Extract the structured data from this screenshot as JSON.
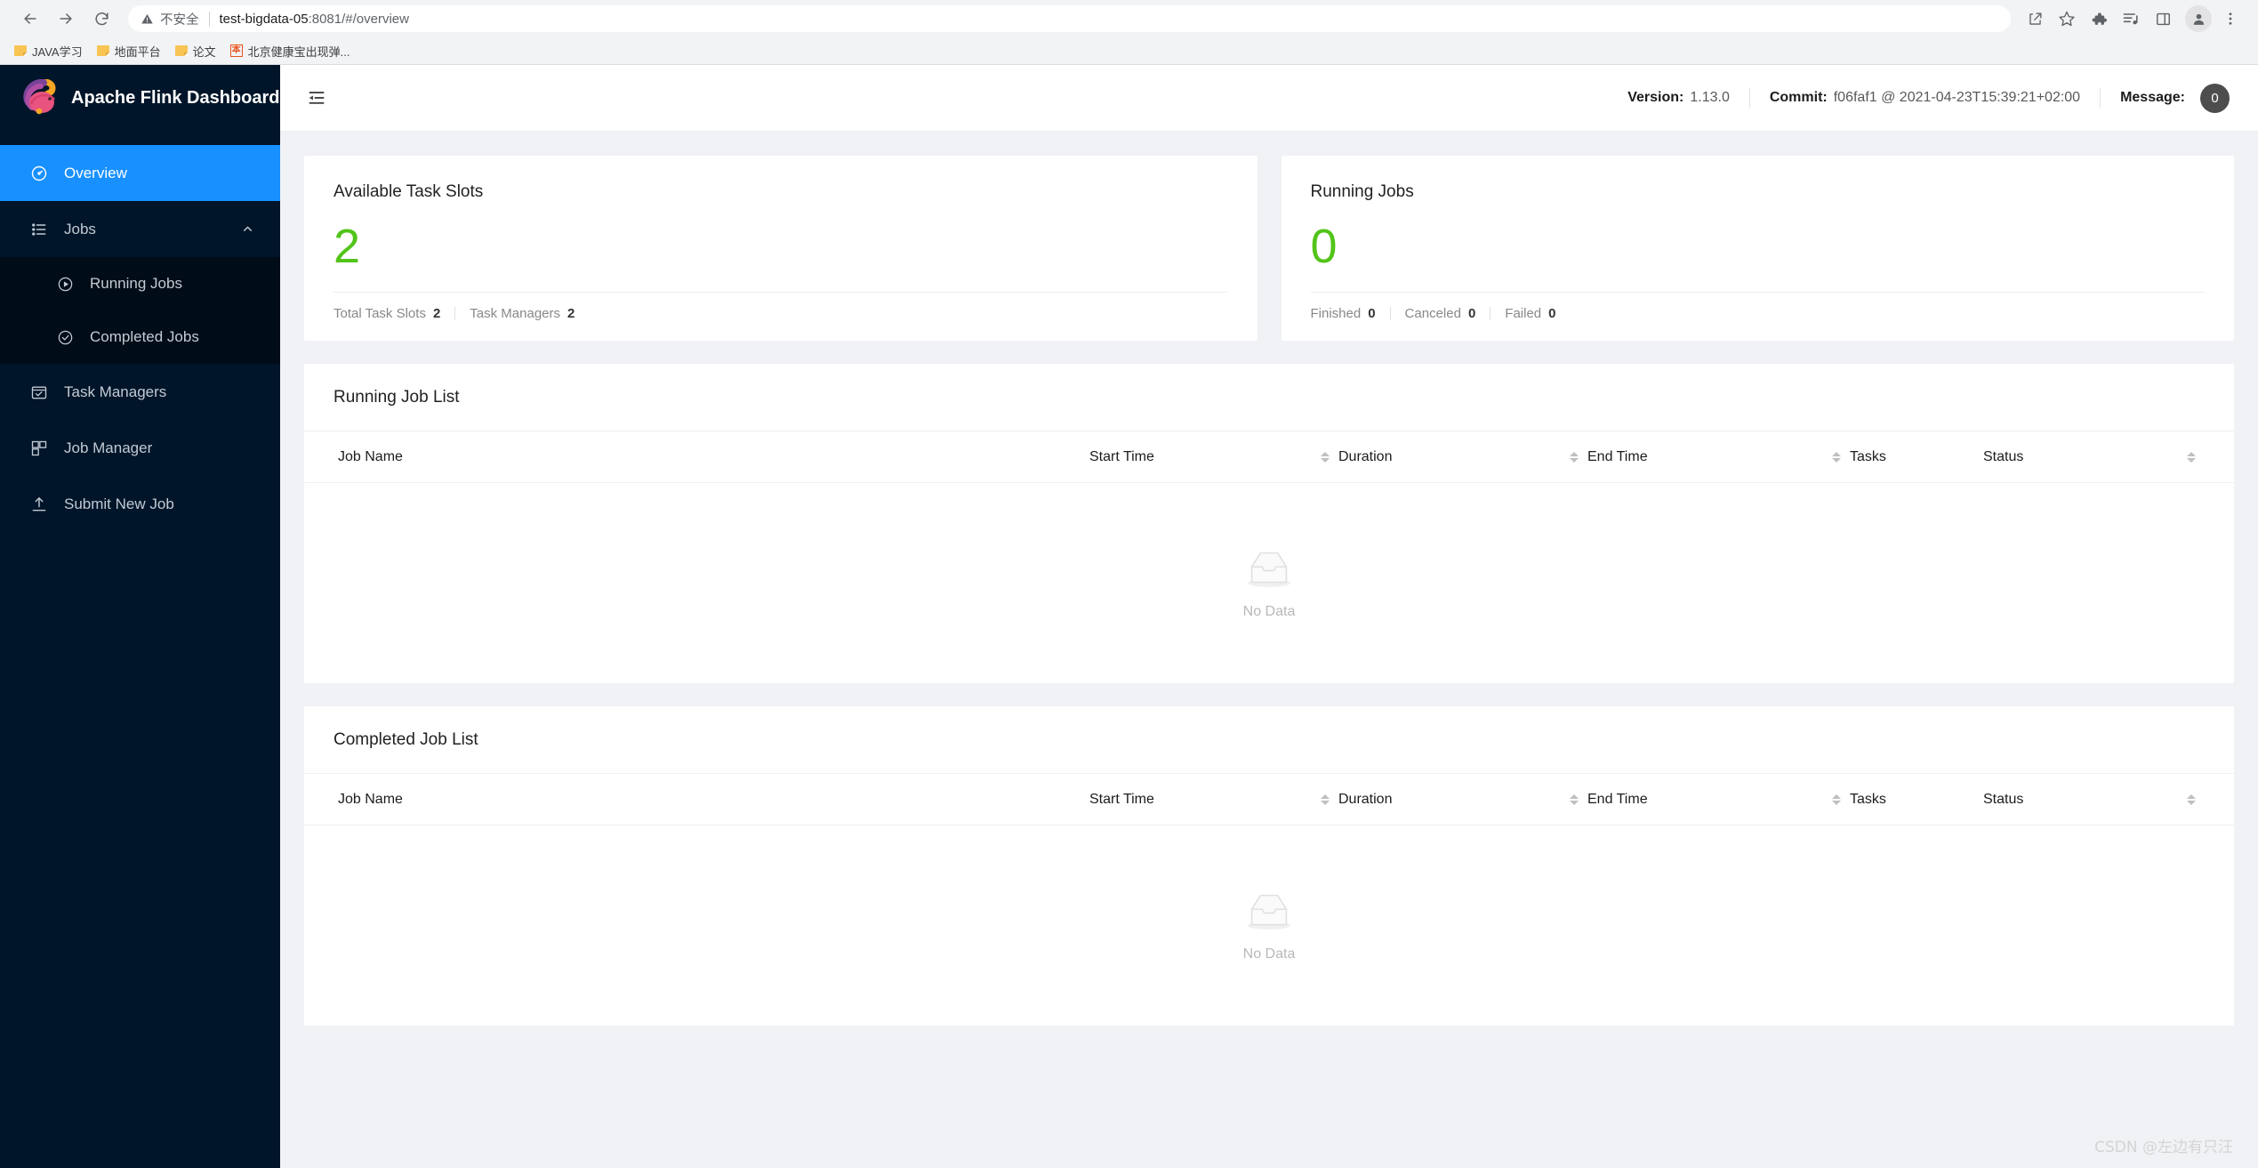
{
  "browser": {
    "back_title": "Back",
    "forward_title": "Forward",
    "reload_title": "Reload",
    "security_label": "不安全",
    "url_main": "test-bigdata-05",
    "url_rest": ":8081/#/overview",
    "toolbar_icons": [
      {
        "name": "share-icon",
        "title": "Share this page"
      },
      {
        "name": "bookmark-star-icon",
        "title": "Bookmark this tab"
      },
      {
        "name": "extensions-puzzle-icon",
        "title": "Extensions"
      },
      {
        "name": "media-playlist-icon",
        "title": "Media controls"
      },
      {
        "name": "side-panel-icon",
        "title": "Side panel"
      },
      {
        "name": "profile-avatar-icon",
        "title": "Profile"
      },
      {
        "name": "more-vertical-icon",
        "title": "Customize and control Chrome"
      }
    ],
    "bookmarks": [
      {
        "label": "JAVA学习",
        "icon": "folder-icon"
      },
      {
        "label": "地面平台",
        "icon": "folder-icon"
      },
      {
        "label": "论文",
        "icon": "folder-icon"
      },
      {
        "label": "北京健康宝出现弹...",
        "icon": "site-favicon-ben"
      }
    ]
  },
  "sidebar": {
    "brand_title": "Apache Flink Dashboard",
    "brand_logo_icon": "flink-squirrel-logo",
    "items": [
      {
        "label": "Overview",
        "icon": "dashboard-gauge-icon",
        "active": true
      },
      {
        "label": "Jobs",
        "icon": "list-icon",
        "active": false,
        "expandable": true,
        "caret": "chevron-up-icon"
      },
      {
        "label": "Running Jobs",
        "icon": "play-circle-icon",
        "active": false,
        "sub": true
      },
      {
        "label": "Completed Jobs",
        "icon": "check-circle-icon",
        "active": false,
        "sub": true
      },
      {
        "label": "Task Managers",
        "icon": "task-manager-icon",
        "active": false
      },
      {
        "label": "Job Manager",
        "icon": "job-manager-icon",
        "active": false
      },
      {
        "label": "Submit New Job",
        "icon": "upload-icon",
        "active": false
      }
    ]
  },
  "topbar": {
    "fold_icon": "menu-fold-icon",
    "version_label": "Version:",
    "version_value": "1.13.0",
    "commit_label": "Commit:",
    "commit_value": "f06faf1 @ 2021-04-23T15:39:21+02:00",
    "message_label": "Message:",
    "message_count": "0"
  },
  "stats": {
    "accent_green": "#52c41a",
    "cards": [
      {
        "title": "Available Task Slots",
        "value": "2",
        "footer": [
          {
            "label": "Total Task Slots",
            "value": "2"
          },
          {
            "label": "Task Managers",
            "value": "2"
          }
        ]
      },
      {
        "title": "Running Jobs",
        "value": "0",
        "footer": [
          {
            "label": "Finished",
            "value": "0"
          },
          {
            "label": "Canceled",
            "value": "0"
          },
          {
            "label": "Failed",
            "value": "0"
          }
        ]
      }
    ]
  },
  "tables": [
    {
      "title": "Running Job List",
      "columns": [
        {
          "label": "Job Name",
          "sortable": false
        },
        {
          "label": "Start Time",
          "sortable": true
        },
        {
          "label": "Duration",
          "sortable": true
        },
        {
          "label": "End Time",
          "sortable": true
        },
        {
          "label": "Tasks",
          "sortable": false
        },
        {
          "label": "Status",
          "sortable": true
        }
      ],
      "rows": [],
      "empty_text": "No Data",
      "empty_icon": "empty-inbox-icon"
    },
    {
      "title": "Completed Job List",
      "columns": [
        {
          "label": "Job Name",
          "sortable": false
        },
        {
          "label": "Start Time",
          "sortable": true
        },
        {
          "label": "Duration",
          "sortable": true
        },
        {
          "label": "End Time",
          "sortable": true
        },
        {
          "label": "Tasks",
          "sortable": false
        },
        {
          "label": "Status",
          "sortable": true
        }
      ],
      "rows": [],
      "empty_text": "No Data",
      "empty_icon": "empty-inbox-icon"
    }
  ],
  "watermark": "CSDN @左边有只汪"
}
